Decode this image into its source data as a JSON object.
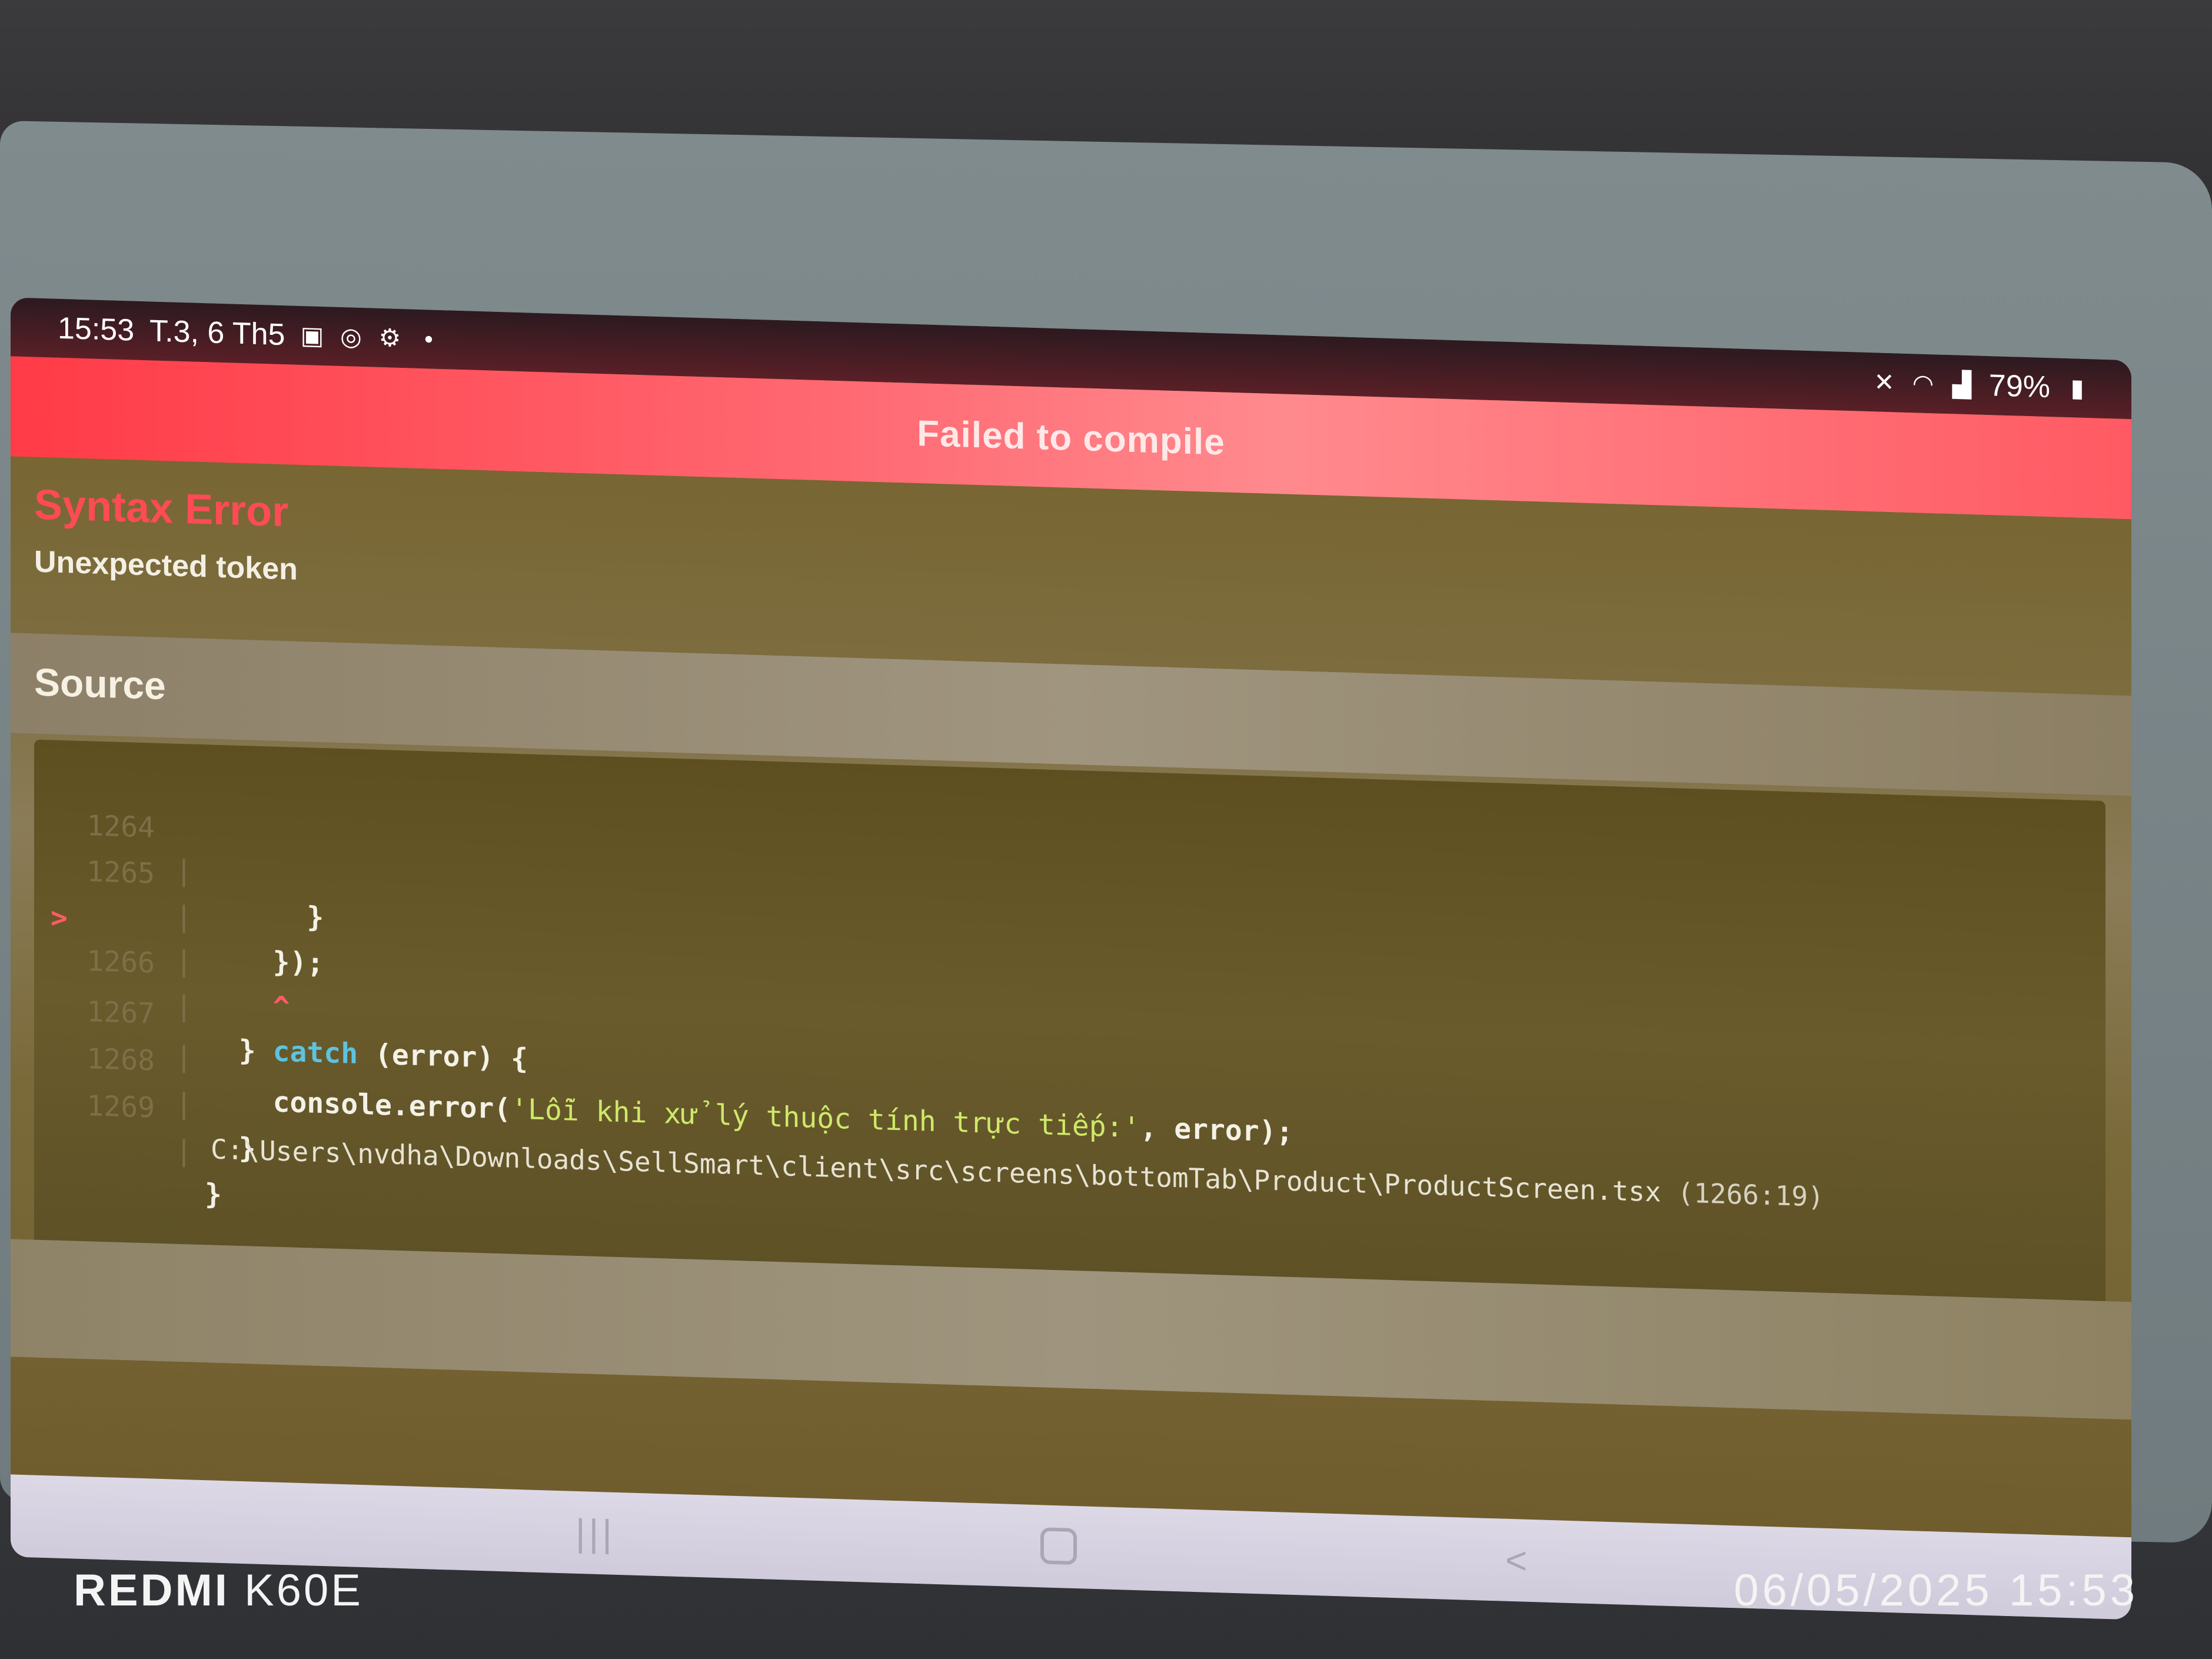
{
  "status_bar": {
    "time": "15:53",
    "date": "T.3, 6 Th5",
    "battery": "79%",
    "icons_left": [
      "message-icon",
      "sync-icon",
      "gear-icon",
      "dot-icon"
    ],
    "icons_right": [
      "mute-icon",
      "wifi-icon",
      "signal-icon",
      "battery-icon"
    ]
  },
  "header": {
    "title": "Failed to compile"
  },
  "error": {
    "type": "Syntax Error",
    "message": "Unexpected token"
  },
  "source": {
    "heading": "Source",
    "lines": [
      {
        "no": "1264",
        "marker": "",
        "code": "      }"
      },
      {
        "no": "1265",
        "marker": "",
        "code": "    });"
      },
      {
        "no": "1266",
        "marker": ">",
        "code_pre": "  } ",
        "code_kw": "catch",
        "code_post": " (error) {"
      },
      {
        "no": "",
        "marker": "",
        "caret": "    ^"
      },
      {
        "no": "1267",
        "marker": "",
        "code_pre": "    console.error(",
        "code_str": "'Lỗi khi xử lý thuộc tính trực tiếp:'",
        "code_post": ", error);"
      },
      {
        "no": "1268",
        "marker": "",
        "code": "  }"
      },
      {
        "no": "1269",
        "marker": "",
        "code": "}"
      }
    ],
    "file_path": "C:\\Users\\nvdha\\Downloads\\SellSmart\\client\\src\\screens\\bottomTab\\Product\\ProductScreen.tsx",
    "location": "(1266:19)"
  },
  "nav": {
    "recent": "|||",
    "back": "<"
  },
  "watermark": {
    "brand": "REDMI",
    "model": "K60E",
    "datetime": "06/05/2025  15:53"
  },
  "colors": {
    "header_red": "#ff5a63",
    "error_red": "#ff4b55",
    "keyword": "#5cc3e0",
    "string": "#cfe86a"
  }
}
